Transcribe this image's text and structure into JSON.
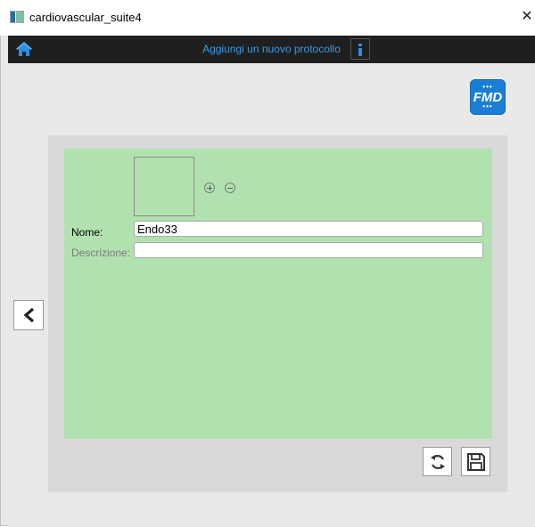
{
  "window": {
    "title": "cardiovascular_suite4",
    "close_glyph": "✕"
  },
  "toolbar": {
    "title": "Aggiungi un nuovo protocollo",
    "home_icon": "home-icon",
    "info_icon": "info-icon"
  },
  "badge": {
    "text": "FMD",
    "dots": "•••",
    "color": "#1a7fd4"
  },
  "form": {
    "nome_label": "Nome:",
    "nome_value": "Endo33",
    "descrizione_label": "Descrizione:",
    "descrizione_value": ""
  },
  "colors": {
    "panel_green": "#b2e1b0",
    "toolbar_dark": "#1f1f1f",
    "accent_blue": "#3a9ae6"
  }
}
